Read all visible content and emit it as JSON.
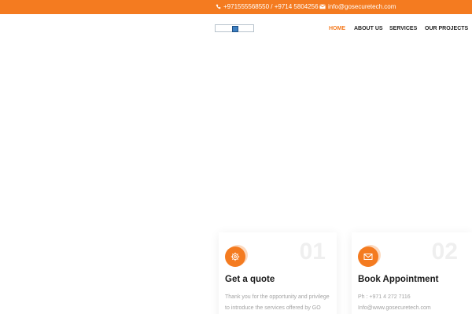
{
  "topbar": {
    "phone": "+971555568550 / +9714 5804256",
    "email": "info@gosecuretech.com"
  },
  "nav": {
    "items": [
      {
        "label": "HOME"
      },
      {
        "label": "ABOUT US"
      },
      {
        "label": "SERVICES"
      },
      {
        "label": "OUR PROJECTS"
      }
    ],
    "services_expand": "+"
  },
  "cards": [
    {
      "number": "01",
      "title": "Get a quote",
      "lines": [
        "Thank you for the opportunity and privilege",
        "to introduce the services offered by GO"
      ]
    },
    {
      "number": "02",
      "title": "Book Appointment",
      "lines": [
        "Ph : +971 4 272 7116",
        "Info@www.gosecuretech.com"
      ]
    }
  ],
  "colors": {
    "accent": "#f47b20",
    "accent_light": "#fcd9bf",
    "text_dark": "#1a1a1a",
    "text_muted": "#a3a3a3"
  }
}
